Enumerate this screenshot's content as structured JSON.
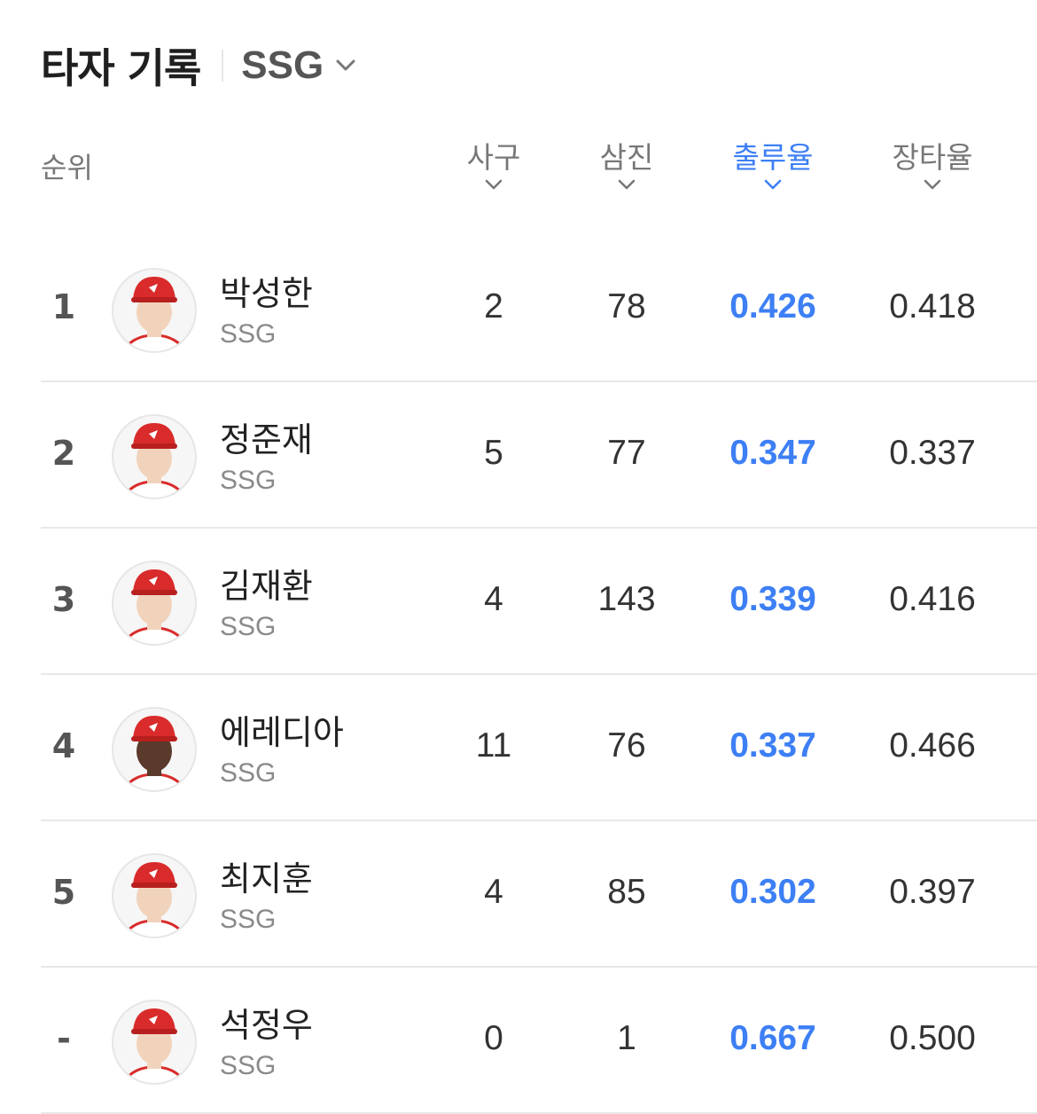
{
  "header": {
    "title": "타자 기록",
    "team": "SSG"
  },
  "columns": {
    "rank": "순위",
    "walks": "사구",
    "strikeouts": "삼진",
    "obp": "출루율",
    "slg": "장타율"
  },
  "accent_color": "#3d7ff5",
  "team_cap_color": "#d92b2b",
  "players": [
    {
      "rank": "1",
      "name": "박성한",
      "team": "SSG",
      "walks": "2",
      "strikeouts": "78",
      "obp": "0.426",
      "slg": "0.418"
    },
    {
      "rank": "2",
      "name": "정준재",
      "team": "SSG",
      "walks": "5",
      "strikeouts": "77",
      "obp": "0.347",
      "slg": "0.337"
    },
    {
      "rank": "3",
      "name": "김재환",
      "team": "SSG",
      "walks": "4",
      "strikeouts": "143",
      "obp": "0.339",
      "slg": "0.416"
    },
    {
      "rank": "4",
      "name": "에레디아",
      "team": "SSG",
      "walks": "11",
      "strikeouts": "76",
      "obp": "0.337",
      "slg": "0.466"
    },
    {
      "rank": "5",
      "name": "최지훈",
      "team": "SSG",
      "walks": "4",
      "strikeouts": "85",
      "obp": "0.302",
      "slg": "0.397"
    },
    {
      "rank": "-",
      "name": "석정우",
      "team": "SSG",
      "walks": "0",
      "strikeouts": "1",
      "obp": "0.667",
      "slg": "0.500"
    }
  ]
}
